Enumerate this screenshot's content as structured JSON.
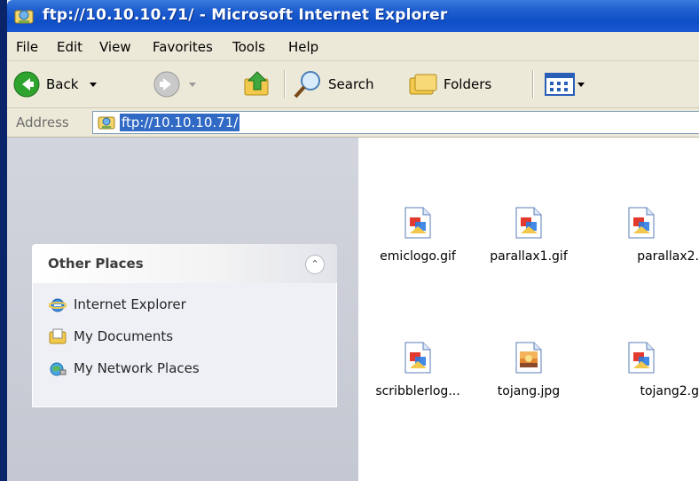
{
  "window": {
    "title": "ftp://10.10.10.71/ - Microsoft Internet Explorer"
  },
  "menu": [
    "File",
    "Edit",
    "View",
    "Favorites",
    "Tools",
    "Help"
  ],
  "toolbar": {
    "back_label": "Back",
    "search_label": "Search",
    "folders_label": "Folders"
  },
  "address": {
    "label": "Address",
    "value": "ftp://10.10.10.71/"
  },
  "side": {
    "other_places_title": "Other Places",
    "places": [
      "Internet Explorer",
      "My Documents",
      "My Network Places"
    ]
  },
  "files": [
    {
      "name": "emiclogo.gif",
      "icon": "gif-image-icon"
    },
    {
      "name": "parallax1.gif",
      "icon": "gif-image-icon"
    },
    {
      "name": "parallax2.",
      "icon": "gif-image-icon"
    },
    {
      "name": "scribblerlog...",
      "icon": "gif-image-icon"
    },
    {
      "name": "tojang.jpg",
      "icon": "jpg-image-icon"
    },
    {
      "name": "tojang2.g",
      "icon": "gif-image-icon"
    }
  ],
  "colors": {
    "title_bar": "#0f4fc7",
    "selection": "#316ac5",
    "chrome": "#ece9d8"
  }
}
